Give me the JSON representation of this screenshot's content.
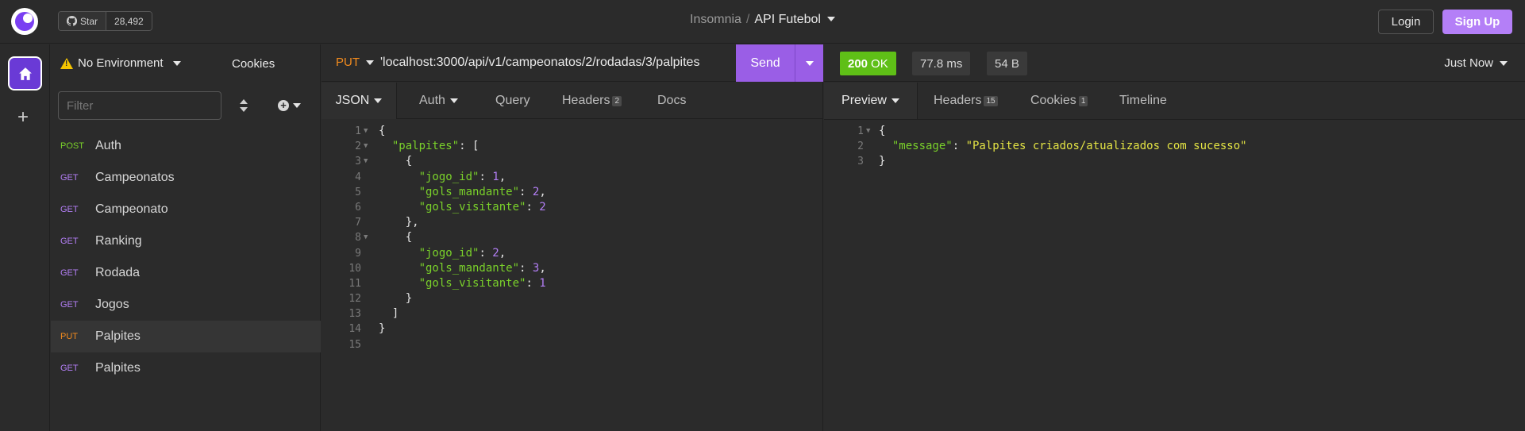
{
  "app": {
    "name": "Insomnia",
    "project": "API Futebol"
  },
  "github": {
    "star_label": "Star",
    "star_count": "28,492"
  },
  "auth": {
    "login": "Login",
    "signup": "Sign Up"
  },
  "sidebar": {
    "environment": "No Environment",
    "cookies": "Cookies",
    "filter_placeholder": "Filter",
    "requests": [
      {
        "method": "POST",
        "name": "Auth"
      },
      {
        "method": "GET",
        "name": "Campeonatos"
      },
      {
        "method": "GET",
        "name": "Campeonato"
      },
      {
        "method": "GET",
        "name": "Ranking"
      },
      {
        "method": "GET",
        "name": "Rodada"
      },
      {
        "method": "GET",
        "name": "Jogos"
      },
      {
        "method": "PUT",
        "name": "Palpites",
        "active": true
      },
      {
        "method": "GET",
        "name": "Palpites"
      }
    ]
  },
  "request": {
    "method": "PUT",
    "url": "'localhost:3000/api/v1/campeonatos/2/rodadas/3/palpites",
    "send": "Send",
    "tabs": {
      "body": "JSON",
      "auth": "Auth",
      "query": "Query",
      "headers": "Headers",
      "headers_count": "2",
      "docs": "Docs"
    },
    "body_lines": [
      {
        "n": "1",
        "fold": true
      },
      {
        "n": "2",
        "fold": true
      },
      {
        "n": "3",
        "fold": true
      },
      {
        "n": "4"
      },
      {
        "n": "5"
      },
      {
        "n": "6"
      },
      {
        "n": "7"
      },
      {
        "n": "8",
        "fold": true
      },
      {
        "n": "9"
      },
      {
        "n": "10"
      },
      {
        "n": "11"
      },
      {
        "n": "12"
      },
      {
        "n": "13"
      },
      {
        "n": "14"
      },
      {
        "n": "15"
      }
    ],
    "body": {
      "key_palpites": "\"palpites\"",
      "k_jogo_id": "\"jogo_id\"",
      "k_gols_mandante": "\"gols_mandante\"",
      "k_gols_visitante": "\"gols_visitante\"",
      "v1_jogo": "1",
      "v1_mand": "2",
      "v1_visit": "2",
      "v2_jogo": "2",
      "v2_mand": "3",
      "v2_visit": "1"
    }
  },
  "response": {
    "status_code": "200",
    "status_text": "OK",
    "time": "77.8 ms",
    "size": "54 B",
    "when": "Just Now",
    "tabs": {
      "preview": "Preview",
      "headers": "Headers",
      "headers_count": "15",
      "cookies": "Cookies",
      "cookies_count": "1",
      "timeline": "Timeline"
    },
    "lines": [
      "1",
      "2",
      "3"
    ],
    "body": {
      "key_message": "\"message\"",
      "val_message": "\"Palpites criados/atualizados com sucesso\""
    }
  },
  "colors": {
    "accent": "#b47ff7",
    "send": "#9a5ee6",
    "ok": "#5fbf17",
    "put": "#f28b1e",
    "get": "#b47ff7",
    "post": "#7ad12a",
    "json_key": "#7ad12a",
    "json_number": "#b47ff7",
    "json_string": "#e4e444"
  }
}
